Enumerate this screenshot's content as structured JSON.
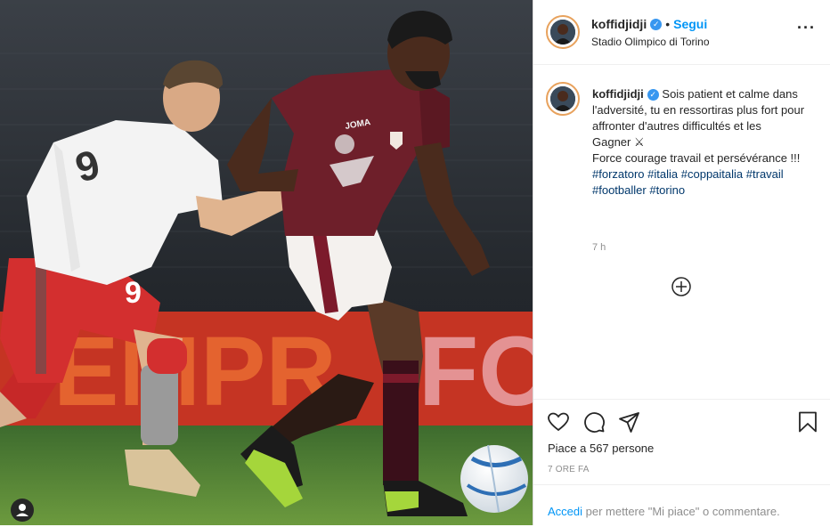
{
  "post": {
    "username": "koffidjidji",
    "follow_label": "Segui",
    "location": "Stadio Olimpico di Torino",
    "caption_username": "koffidjidji",
    "caption_lines": [
      "Sois patient et calme dans l'adversité, tu en ressortiras plus fort pour affronter d'autres difficultés et les",
      "Gagner ⚔",
      "Force courage travail et persévérance !!!"
    ],
    "hashtags": [
      "#forzatoro",
      "#italia",
      "#coppaitalia",
      "#travail",
      "#footballer",
      "#torino"
    ],
    "time_short": "7 h",
    "likes_text": "Piace a 567 persone",
    "time_long": "7 ORE FA",
    "login_link": "Accedi",
    "login_rest": " per mettere \"Mi piace\" o commentare."
  },
  "photo": {
    "banner_text": "EMPR",
    "banner_text2": "FO",
    "jersey_left_number": "9",
    "jersey_right_text": "JOMA"
  },
  "icons": {
    "more": "more-options-icon",
    "like": "heart-icon",
    "comment": "comment-icon",
    "share": "share-icon",
    "save": "bookmark-icon",
    "add_comment": "plus-circle-icon",
    "tag": "user-tag-icon"
  },
  "colors": {
    "link": "#0095f6",
    "hashtag": "#00376b",
    "muted": "#8e8e8e",
    "verified": "#3897f0"
  }
}
